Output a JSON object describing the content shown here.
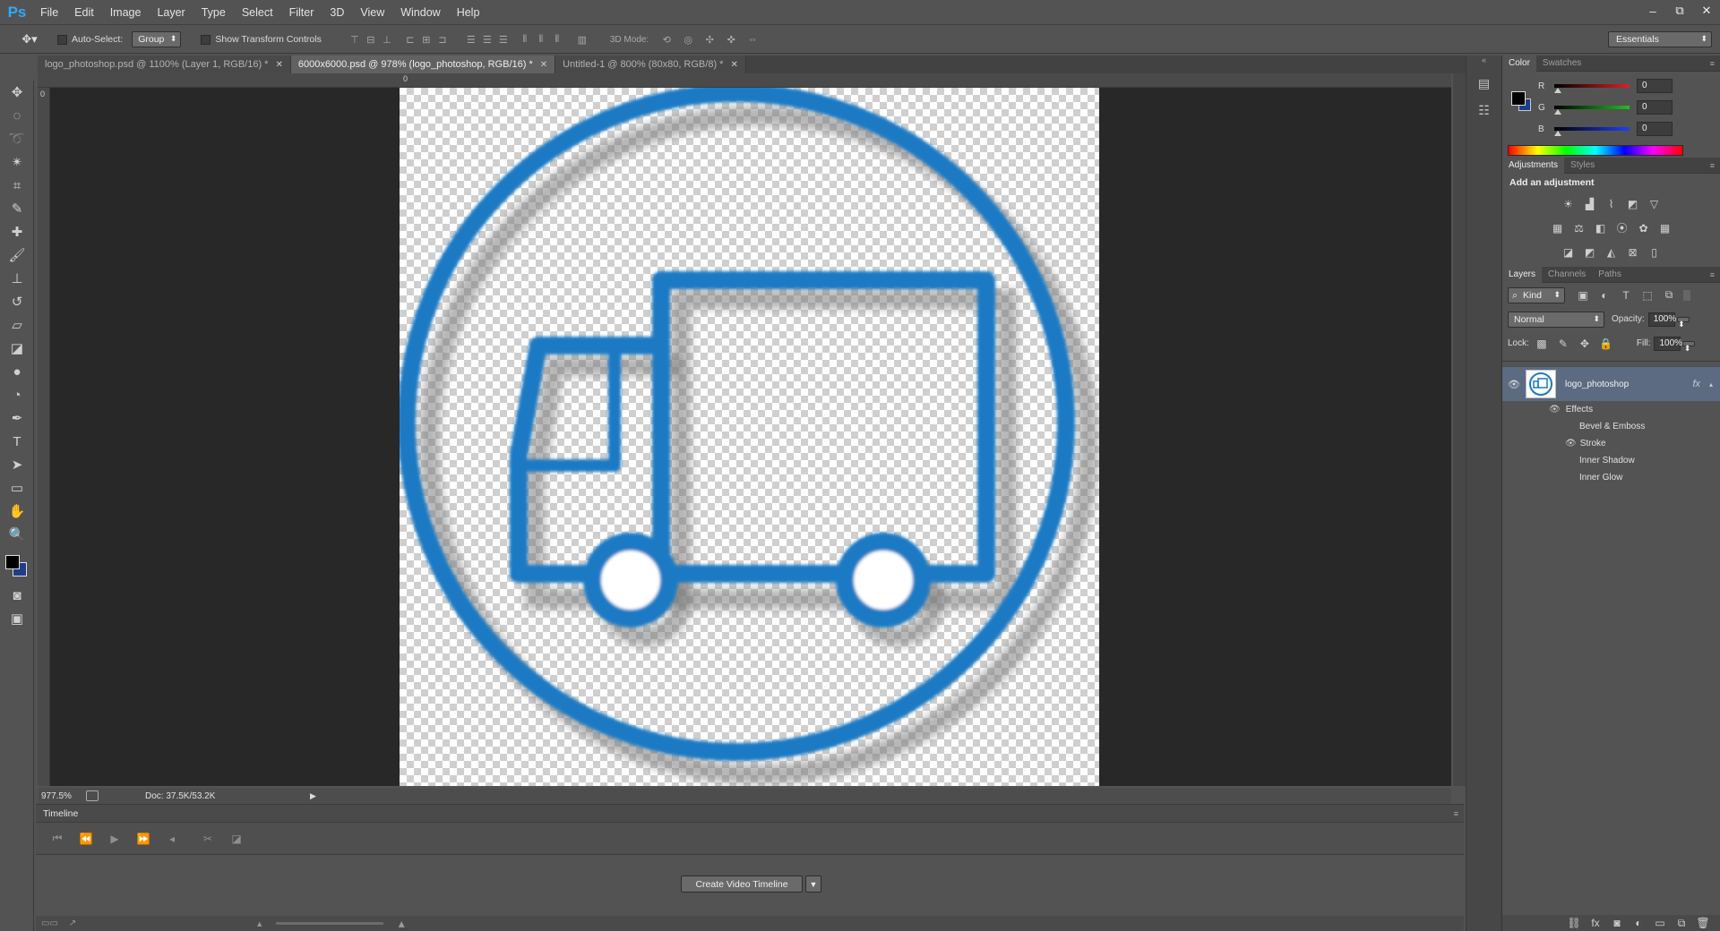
{
  "app": {
    "logo": "Ps"
  },
  "menu": [
    "File",
    "Edit",
    "Image",
    "Layer",
    "Type",
    "Select",
    "Filter",
    "3D",
    "View",
    "Window",
    "Help"
  ],
  "window_controls": [
    "–",
    "⧉",
    "✕"
  ],
  "options": {
    "auto_select_label": "Auto-Select:",
    "auto_select_value": "Group",
    "transform_label": "Show Transform Controls",
    "mode3d_label": "3D Mode:",
    "workspace": "Essentials"
  },
  "tabs": [
    {
      "label": "logo_photoshop.psd @ 1100% (Layer 1, RGB/16) *",
      "active": false
    },
    {
      "label": "6000x6000.psd @ 978% (logo_photoshop, RGB/16) *",
      "active": true
    },
    {
      "label": "Untitled-1 @ 800% (80x80, RGB/8) *",
      "active": false
    }
  ],
  "ruler": {
    "top_zero": "0",
    "left_zero": "0"
  },
  "status": {
    "zoom": "977.5%",
    "doc": "Doc: 37.5K/53.2K"
  },
  "timeline": {
    "title": "Timeline",
    "create_label": "Create Video Timeline"
  },
  "color_panel": {
    "tabs": [
      "Color",
      "Swatches"
    ],
    "channels": [
      {
        "label": "R",
        "value": "0",
        "color": "#e02020"
      },
      {
        "label": "G",
        "value": "0",
        "color": "#20c020"
      },
      {
        "label": "B",
        "value": "0",
        "color": "#2040f0"
      }
    ]
  },
  "adjustments": {
    "tabs": [
      "Adjustments",
      "Styles"
    ],
    "heading": "Add an adjustment"
  },
  "layers": {
    "tabs": [
      "Layers",
      "Channels",
      "Paths"
    ],
    "kind_label": "Kind",
    "blend_mode": "Normal",
    "opacity_label": "Opacity:",
    "opacity": "100%",
    "lock_label": "Lock:",
    "fill_label": "Fill:",
    "fill": "100%",
    "layer_name": "logo_photoshop",
    "fx_label": "fx",
    "effects_label": "Effects",
    "effects": [
      "Bevel & Emboss",
      "Stroke",
      "Inner Shadow",
      "Inner Glow"
    ]
  },
  "colors": {
    "accent_blue": "#1a7ac4",
    "selected_layer": "#5c6b82"
  }
}
